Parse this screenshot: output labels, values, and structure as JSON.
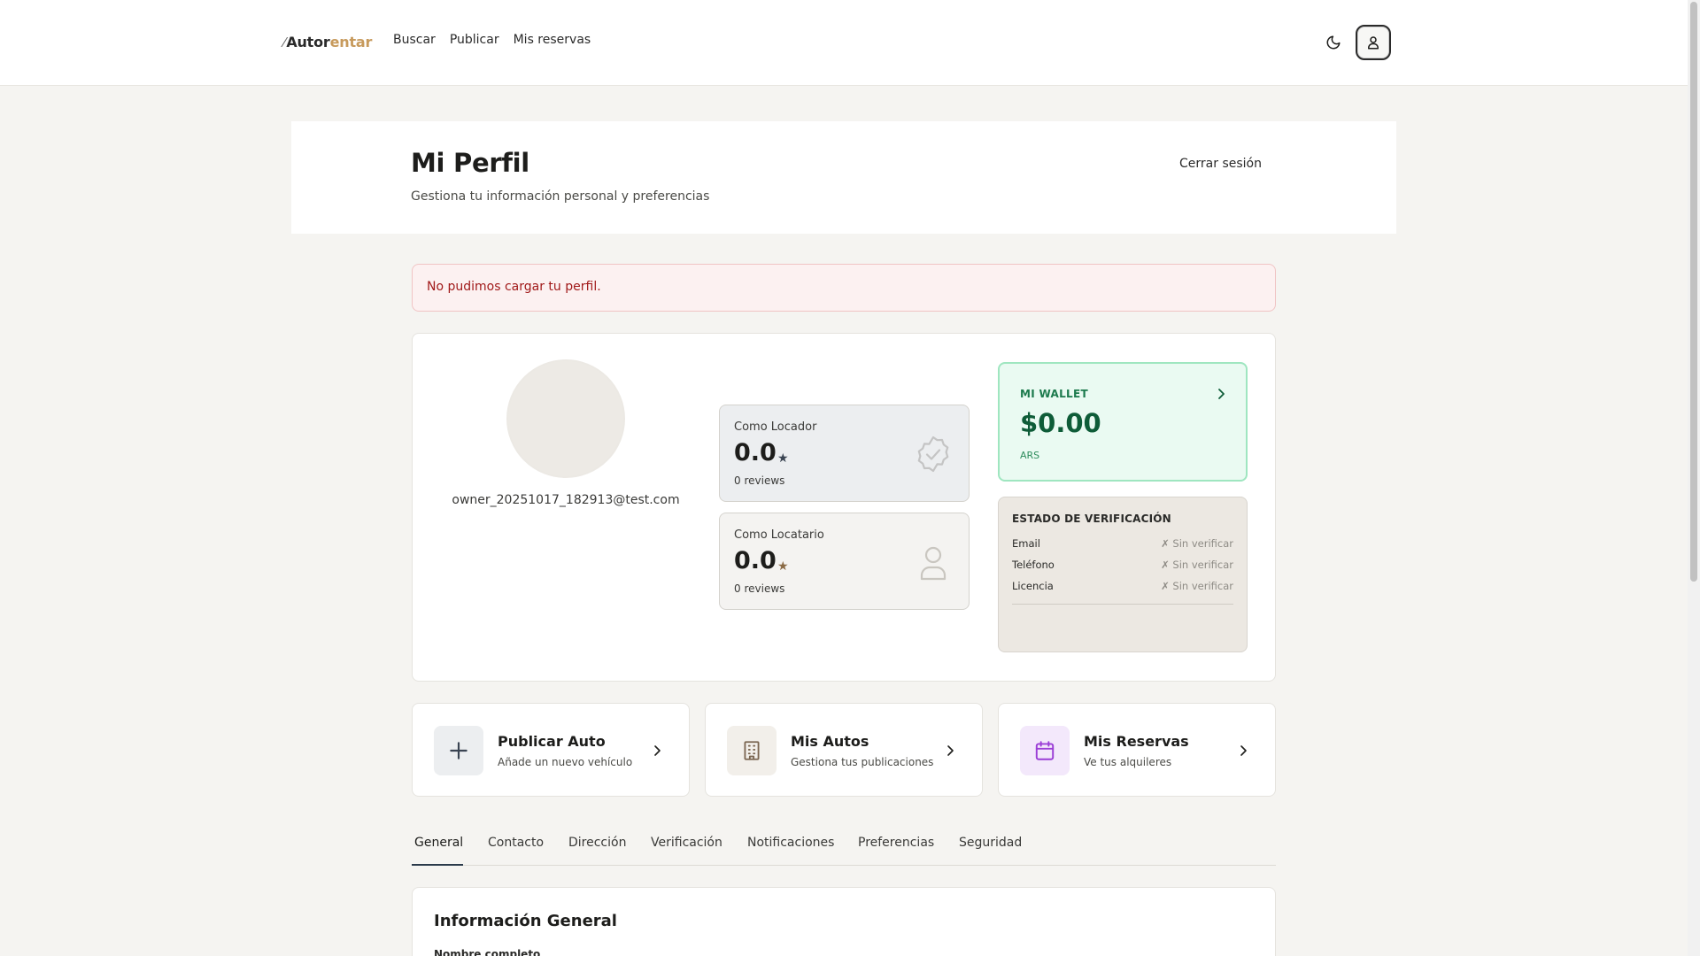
{
  "header": {
    "logo_part1": "Autor",
    "logo_part2": "entar",
    "nav": [
      "Buscar",
      "Publicar",
      "Mis reservas"
    ]
  },
  "profile": {
    "title": "Mi Perfil",
    "subtitle": "Gestiona tu información personal y preferencias",
    "logout": "Cerrar sesión",
    "error": "No pudimos cargar tu perfil.",
    "email": "owner_20251017_182913@test.com"
  },
  "ratings": {
    "locador": {
      "label": "Como Locador",
      "value": "0.0",
      "star": "★",
      "reviews": "0 reviews"
    },
    "locatario": {
      "label": "Como Locatario",
      "value": "0.0",
      "star": "★",
      "reviews": "0 reviews"
    }
  },
  "wallet": {
    "label": "MI WALLET",
    "amount": "$0.00",
    "currency": "ARS"
  },
  "verification": {
    "title": "ESTADO DE VERIFICACIÓN",
    "rows": [
      {
        "label": "Email",
        "status": "✗ Sin verificar"
      },
      {
        "label": "Teléfono",
        "status": "✗ Sin verificar"
      },
      {
        "label": "Licencia",
        "status": "✗ Sin verificar"
      }
    ]
  },
  "actions": [
    {
      "title": "Publicar Auto",
      "subtitle": "Añade un nuevo vehículo",
      "icon": "plus-icon",
      "bg": "#eceef0"
    },
    {
      "title": "Mis Autos",
      "subtitle": "Gestiona tus publicaciones",
      "icon": "building-icon",
      "bg": "#f2efea"
    },
    {
      "title": "Mis Reservas",
      "subtitle": "Ve tus alquileres",
      "icon": "calendar-icon",
      "bg": "#f3e8fb"
    }
  ],
  "tabs": [
    "General",
    "Contacto",
    "Dirección",
    "Verificación",
    "Notificaciones",
    "Preferencias",
    "Seguridad"
  ],
  "active_tab": "General",
  "info_section": {
    "title": "Información General",
    "field_label": "Nombre completo"
  },
  "colors": {
    "wallet_green": "#0e5c38",
    "error_red": "#a11a1a",
    "calendar_purple": "#9b3ed6"
  }
}
